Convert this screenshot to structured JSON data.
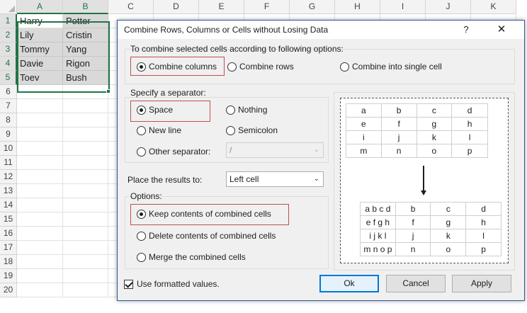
{
  "sheet": {
    "columns": [
      "A",
      "B",
      "C",
      "D",
      "E",
      "F",
      "G",
      "H",
      "I",
      "J",
      "K"
    ],
    "rows": [
      "1",
      "2",
      "3",
      "4",
      "5",
      "6",
      "7",
      "8",
      "9",
      "10",
      "11",
      "12",
      "13",
      "14",
      "15",
      "16",
      "17",
      "18",
      "19",
      "20"
    ],
    "cells": [
      [
        "Harry",
        "Potter"
      ],
      [
        "Lily",
        "Cristin"
      ],
      [
        "Tommy",
        "Yang"
      ],
      [
        "Davie",
        "Rigon"
      ],
      [
        "Toev",
        "Bush"
      ]
    ],
    "selection_color": "#217346"
  },
  "dialog": {
    "title": "Combine Rows, Columns or Cells without Losing Data",
    "help_icon": "?",
    "close_icon": "✕",
    "combine_group_label": "To combine selected cells according to following options:",
    "combine_options": [
      {
        "label": "Combine columns",
        "selected": true
      },
      {
        "label": "Combine rows",
        "selected": false
      },
      {
        "label": "Combine into single cell",
        "selected": false
      }
    ],
    "separator_group_label": "Specify a separator:",
    "separator_options": [
      {
        "label": "Space",
        "selected": true
      },
      {
        "label": "Nothing",
        "selected": false
      },
      {
        "label": "New line",
        "selected": false
      },
      {
        "label": "Semicolon",
        "selected": false
      },
      {
        "label": "Other separator:",
        "selected": false
      }
    ],
    "other_separator_value": "/",
    "place_results_label": "Place the results to:",
    "place_results_value": "Left cell",
    "options_group_label": "Options:",
    "options": [
      {
        "label": "Keep contents of combined cells",
        "selected": true
      },
      {
        "label": "Delete contents of combined cells",
        "selected": false
      },
      {
        "label": "Merge the combined cells",
        "selected": false
      }
    ],
    "use_formatted_label": "Use formatted values.",
    "use_formatted_checked": true,
    "buttons": {
      "ok": "Ok",
      "cancel": "Cancel",
      "apply": "Apply"
    },
    "highlight_color": "#c0504d",
    "preview": {
      "before": [
        [
          "a",
          "b",
          "c",
          "d"
        ],
        [
          "e",
          "f",
          "g",
          "h"
        ],
        [
          "i",
          "j",
          "k",
          "l"
        ],
        [
          "m",
          "n",
          "o",
          "p"
        ]
      ],
      "after": [
        [
          "a b c d",
          "b",
          "c",
          "d"
        ],
        [
          "e f g h",
          "f",
          "g",
          "h"
        ],
        [
          "i j k l",
          "j",
          "k",
          "l"
        ],
        [
          "m n o p",
          "n",
          "o",
          "p"
        ]
      ]
    }
  }
}
